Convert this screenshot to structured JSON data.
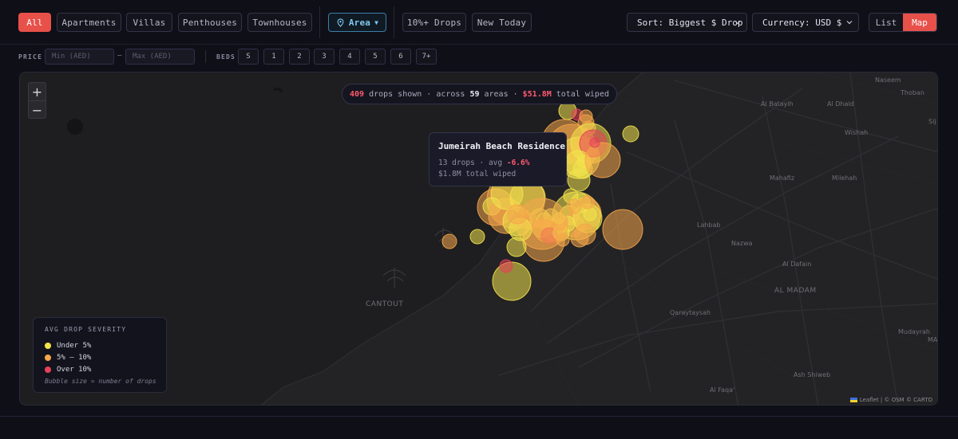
{
  "filters": {
    "types": [
      {
        "label": "All",
        "active": true
      },
      {
        "label": "Apartments",
        "active": false
      },
      {
        "label": "Villas",
        "active": false
      },
      {
        "label": "Penthouses",
        "active": false
      },
      {
        "label": "Townhouses",
        "active": false
      }
    ],
    "area_label": "Area",
    "drops_10_label": "10%+ Drops",
    "new_today_label": "New Today"
  },
  "sort": {
    "label": "Sort: Biggest $ Drop"
  },
  "currency": {
    "label": "Currency: USD $"
  },
  "view_toggle": {
    "list_label": "List",
    "map_label": "Map",
    "active": "Map"
  },
  "price": {
    "label": "PRICE",
    "min_placeholder": "Min (AED)",
    "max_placeholder": "Max (AED)",
    "dash": "–"
  },
  "beds": {
    "label": "BEDS",
    "options": [
      "S",
      "1",
      "2",
      "3",
      "4",
      "5",
      "6",
      "7+"
    ]
  },
  "map": {
    "zoom_in": "+",
    "zoom_out": "−",
    "summary": {
      "drops_count": "409",
      "drops_text": "drops shown",
      "sep": "·",
      "across_text": "across",
      "areas_count": "59",
      "areas_text": "areas",
      "total": "$51.8M",
      "total_text": "total wiped"
    },
    "tooltip": {
      "title": "Jumeirah Beach Residence",
      "drops": "13 drops",
      "avg_label": "· avg",
      "avg": "-6.6%",
      "total": "$1.8M total wiped"
    },
    "place_labels": [
      "Naseem",
      "Thoban",
      "Al Batayih",
      "Al Dhaid",
      "Wishah",
      "Sij",
      "Mahafiz",
      "Milehah",
      "Lahbab",
      "Nazwa",
      "Al Dafain",
      "AL MADAM",
      "CANTOUT",
      "Qaraytaysah",
      "Mudayrah",
      "MA",
      "Ash Shiweb",
      "Al Faqa'"
    ],
    "legend": {
      "title": "AVG DROP SEVERITY",
      "items": [
        {
          "label": "Under 5%",
          "color": "#f2e34c"
        },
        {
          "label": "5% – 10%",
          "color": "#f5a64a"
        },
        {
          "label": "Over 10%",
          "color": "#e8405a"
        }
      ],
      "note": "Bubble size = number of drops"
    },
    "attribution": "Leaflet | © OSM © CARTO"
  },
  "colors": {
    "accent": "#e8504a",
    "under5": "#f2e34c",
    "mid": "#f5a64a",
    "over10": "#e8405a"
  }
}
